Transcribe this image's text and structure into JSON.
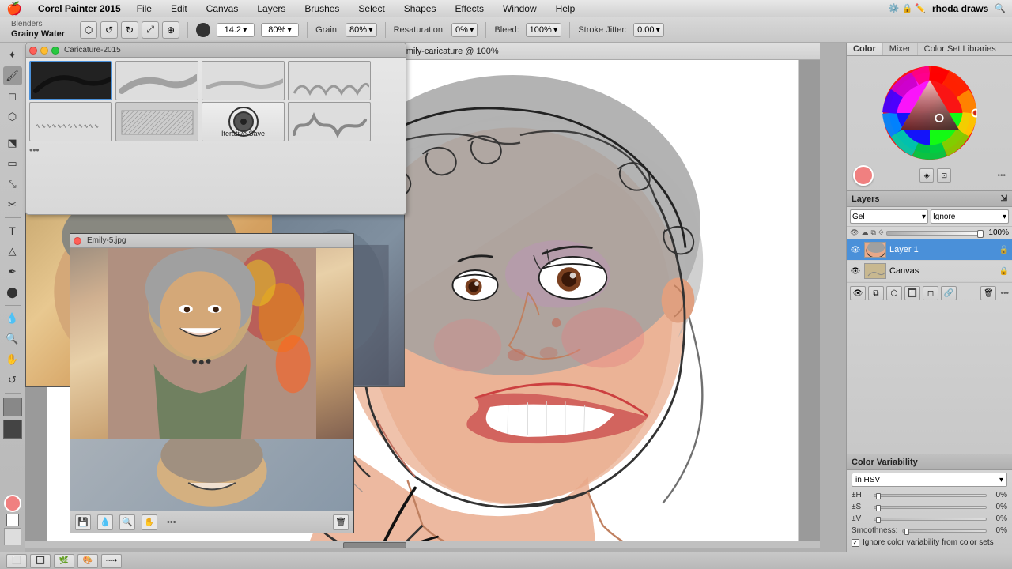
{
  "menubar": {
    "apple": "🍎",
    "app_name": "Corel Painter 2015",
    "menus": [
      "File",
      "Edit",
      "Canvas",
      "Layers",
      "Brushes",
      "Select",
      "Shapes",
      "Effects",
      "Window",
      "Help"
    ],
    "right_text": "rhoda draws"
  },
  "tooloptions": {
    "brush_category": "Blenders",
    "brush_name": "Grainy Water",
    "size_label": "14.2",
    "opacity_label": "80%",
    "grain_label": "Grain:",
    "grain_value": "80%",
    "resaturation_label": "Resaturation:",
    "resaturation_value": "0%",
    "bleed_label": "Bleed:",
    "bleed_value": "100%",
    "stroke_jitter_label": "Stroke Jitter:",
    "stroke_jitter_value": "0.00"
  },
  "brush_panel": {
    "title": "Caricature-2015",
    "iterative_save": "Iterative Save",
    "more_dots": "•••"
  },
  "canvas": {
    "title": "Emily-caricature @ 100%"
  },
  "ref_panel": {
    "title": "Emily-5.jpg"
  },
  "right": {
    "tabs": [
      "Color",
      "Mixer",
      "Color Set Libraries"
    ],
    "color_preview": "#f08080"
  },
  "layers": {
    "title": "Layers",
    "blend_mode": "Gel",
    "composite": "Ignore",
    "opacity": "100%",
    "items": [
      {
        "name": "Layer 1",
        "visible": true,
        "active": true
      },
      {
        "name": "Canvas",
        "visible": true,
        "active": false
      }
    ]
  },
  "color_variability": {
    "title": "Color Variability",
    "mode": "in HSV",
    "h_label": "±H",
    "h_value": "0%",
    "s_label": "±S",
    "s_value": "0%",
    "v_label": "±V",
    "v_value": "0%",
    "smoothness_label": "Smoothness:",
    "smoothness_value": "0%",
    "checkbox_label": "Ignore color variability from color sets",
    "checkbox_checked": true
  },
  "statusbar": {
    "info": ""
  },
  "bottom_dock": {
    "items": [
      "⬜",
      "🔲",
      "🌿",
      "🎨",
      "⟿"
    ]
  }
}
